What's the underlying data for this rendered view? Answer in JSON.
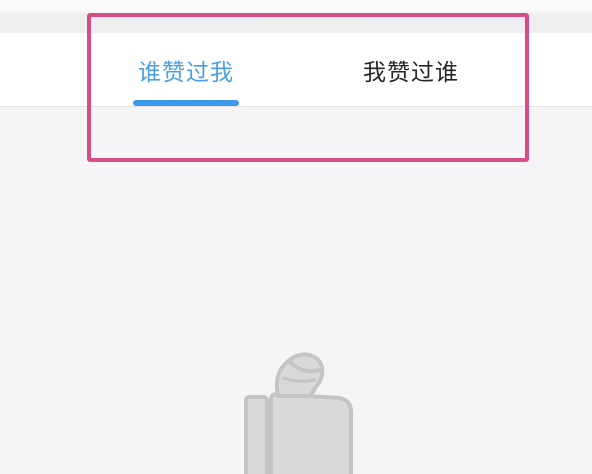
{
  "tabs": [
    {
      "label": "谁赞过我",
      "active": true
    },
    {
      "label": "我赞过谁",
      "active": false
    }
  ],
  "empty_state": {
    "icon": "thumbs-up-icon"
  },
  "colors": {
    "active_tab": "#4a9fe2",
    "inactive_tab": "#262626",
    "underline": "#3d9aea",
    "highlight_annotation": "#d84d88",
    "background": "#f5f5f7",
    "icon_fill": "#d9d9db",
    "icon_stroke": "#c4c4c6"
  }
}
